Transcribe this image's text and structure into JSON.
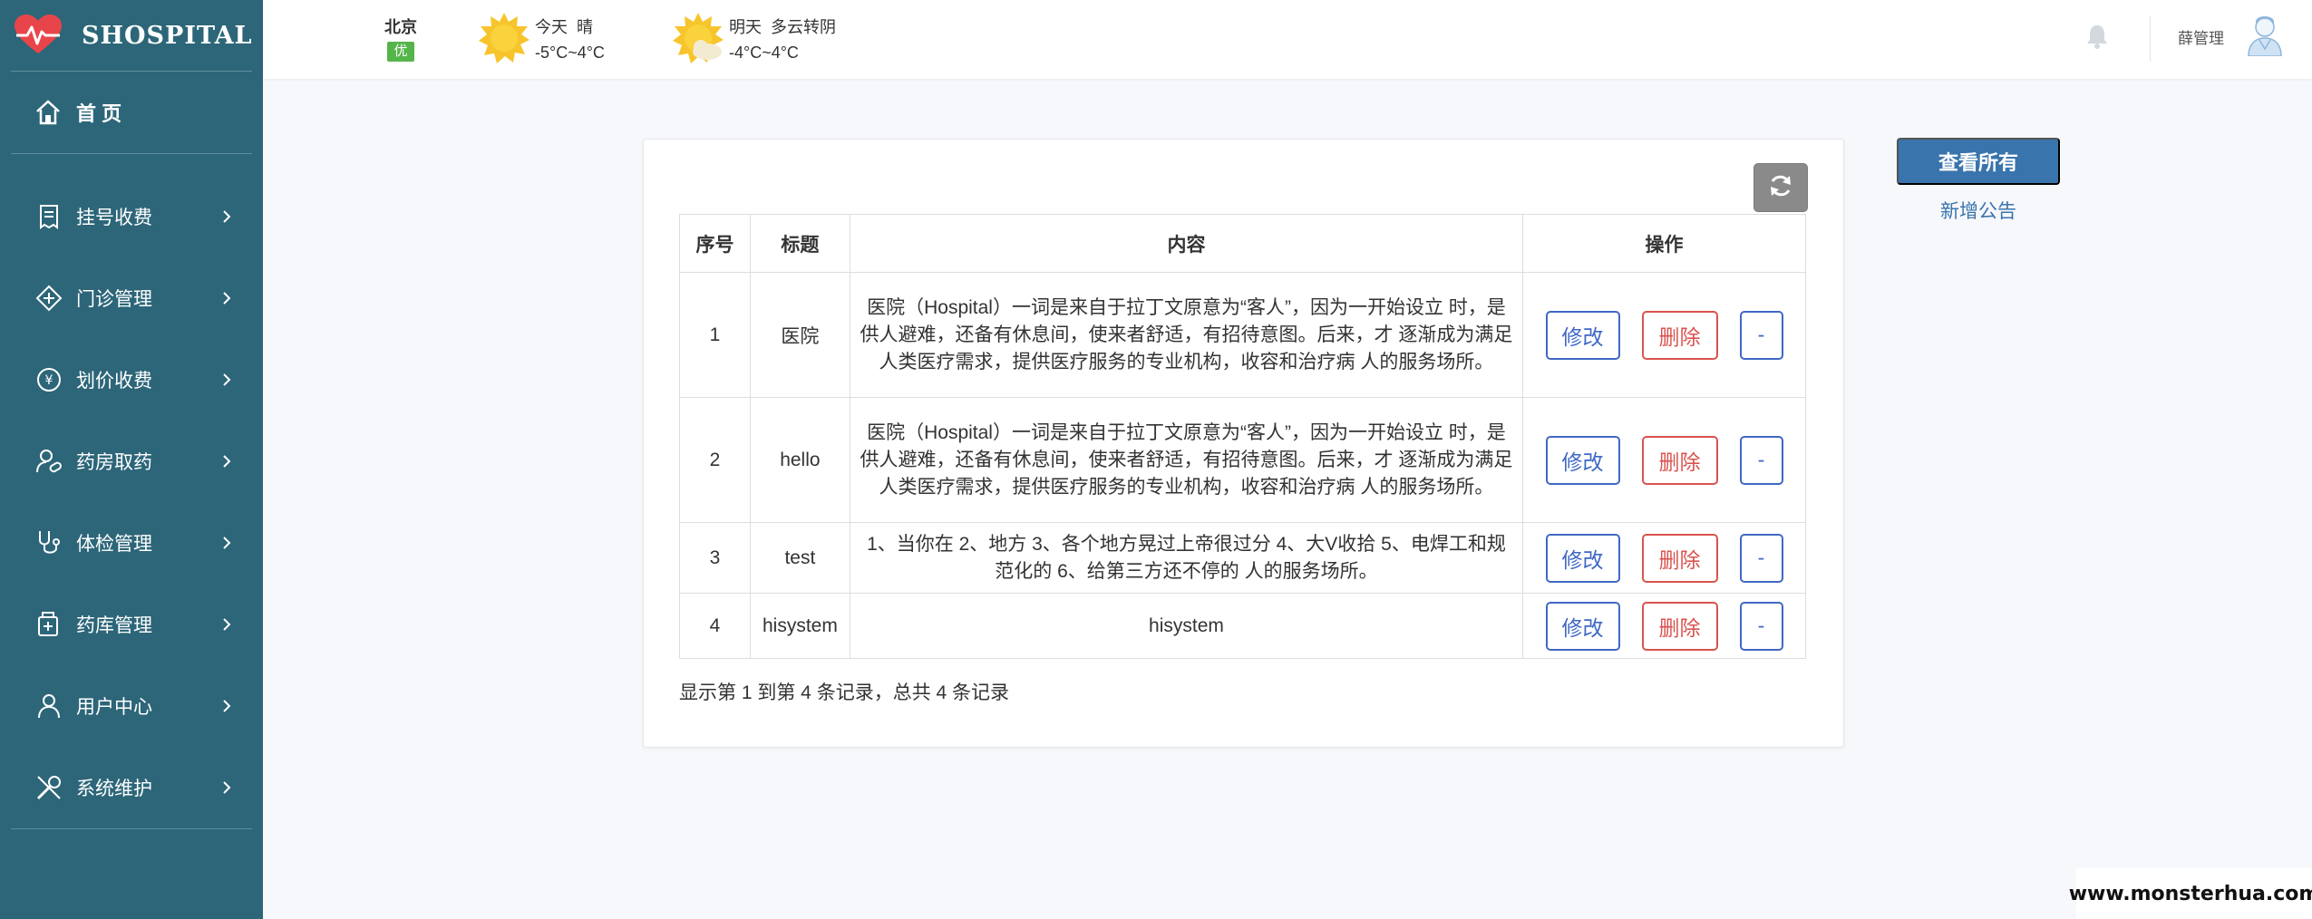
{
  "app": {
    "name": "SHOSPITAL"
  },
  "sidebar": {
    "home_label": "首 页",
    "items": [
      {
        "label": "挂号收费",
        "icon": "receipt-icon"
      },
      {
        "label": "门诊管理",
        "icon": "stethoscope-cross-icon"
      },
      {
        "label": "划价收费",
        "icon": "yuan-coin-icon"
      },
      {
        "label": "药房取药",
        "icon": "pharmacy-icon"
      },
      {
        "label": "体检管理",
        "icon": "stethoscope-icon"
      },
      {
        "label": "药库管理",
        "icon": "medicine-box-icon"
      },
      {
        "label": "用户中心",
        "icon": "user-icon"
      },
      {
        "label": "系统维护",
        "icon": "tools-icon"
      }
    ]
  },
  "header": {
    "city": "北京",
    "aqi": "优",
    "today": {
      "label": "今天",
      "condition": "晴",
      "temp": "-5°C~4°C"
    },
    "tomorrow": {
      "label": "明天",
      "condition": "多云转阴",
      "temp": "-4°C~4°C"
    },
    "user_name": "薛管理"
  },
  "table": {
    "headers": [
      "序号",
      "标题",
      "内容",
      "操作"
    ],
    "edit_label": "修改",
    "delete_label": "删除",
    "dash_label": "-",
    "rows": [
      {
        "no": "1",
        "title": "医院",
        "content": "医院（Hospital）一词是来自于拉丁文原意为“客人”，因为一开始设立 时，是供人避难，还备有休息间，使来者舒适，有招待意图。后来，才 逐渐成为满足人类医疗需求，提供医疗服务的专业机构，收容和治疗病 人的服务场所。"
      },
      {
        "no": "2",
        "title": "hello",
        "content": "医院（Hospital）一词是来自于拉丁文原意为“客人”，因为一开始设立 时，是供人避难，还备有休息间，使来者舒适，有招待意图。后来，才 逐渐成为满足人类医疗需求，提供医疗服务的专业机构，收容和治疗病 人的服务场所。"
      },
      {
        "no": "3",
        "title": "test",
        "content": "1、当你在 2、地方 3、各个地方晃过上帝很过分 4、大V收拾 5、电焊工和规范化的 6、给第三方还不停的 人的服务场所。"
      },
      {
        "no": "4",
        "title": "hisystem",
        "content": "hisystem"
      }
    ],
    "summary": "显示第 1 到第 4 条记录，总共 4 条记录"
  },
  "actions": {
    "view_all": "查看所有",
    "add_notice": "新增公告"
  },
  "watermark": "www.monsterhua.com",
  "colors": {
    "sidebar_bg": "#2d6679",
    "primary": "#3a74ad",
    "danger": "#d9534f",
    "edit": "#3f68c4"
  }
}
